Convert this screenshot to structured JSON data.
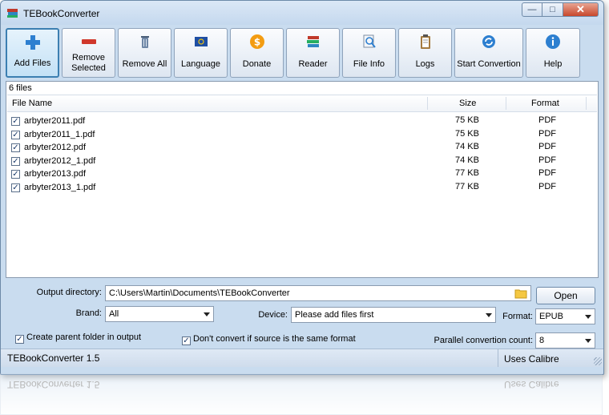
{
  "window": {
    "title": "TEBookConverter",
    "controls": {
      "minimize": "—",
      "maximize": "□",
      "close": "✕"
    }
  },
  "toolbar": {
    "buttons": [
      {
        "id": "add-files",
        "label": "Add Files",
        "icon": "plus-icon",
        "active": true
      },
      {
        "id": "remove-selected",
        "label": "Remove Selected",
        "icon": "minus-icon"
      },
      {
        "id": "remove-all",
        "label": "Remove All",
        "icon": "trash-icon"
      },
      {
        "id": "language",
        "label": "Language",
        "icon": "flag-icon"
      },
      {
        "id": "donate",
        "label": "Donate",
        "icon": "dollar-coin-icon"
      },
      {
        "id": "reader",
        "label": "Reader",
        "icon": "books-icon"
      },
      {
        "id": "file-info",
        "label": "File Info",
        "icon": "magnifier-icon"
      },
      {
        "id": "logs",
        "label": "Logs",
        "icon": "clipboard-icon"
      },
      {
        "id": "start-convertion",
        "label": "Start Convertion",
        "icon": "refresh-icon"
      },
      {
        "id": "help",
        "label": "Help",
        "icon": "info-icon"
      }
    ]
  },
  "files": {
    "count_label": "6 files",
    "columns": {
      "name": "File Name",
      "size": "Size",
      "format": "Format"
    },
    "rows": [
      {
        "name": "arbyter2011.pdf",
        "size": "75 KB",
        "format": "PDF",
        "checked": true
      },
      {
        "name": "arbyter2011_1.pdf",
        "size": "75 KB",
        "format": "PDF",
        "checked": true
      },
      {
        "name": "arbyter2012.pdf",
        "size": "74 KB",
        "format": "PDF",
        "checked": true
      },
      {
        "name": "arbyter2012_1.pdf",
        "size": "74 KB",
        "format": "PDF",
        "checked": true
      },
      {
        "name": "arbyter2013.pdf",
        "size": "77 KB",
        "format": "PDF",
        "checked": true
      },
      {
        "name": "arbyter2013_1.pdf",
        "size": "77 KB",
        "format": "PDF",
        "checked": true
      }
    ]
  },
  "options": {
    "output_label": "Output directory:",
    "output_value": "C:\\Users\\Martin\\Documents\\TEBookConverter",
    "open_label": "Open",
    "brand_label": "Brand:",
    "brand_value": "All",
    "device_label": "Device:",
    "device_value": "Please add files first",
    "format_label": "Format:",
    "format_value": "EPUB",
    "create_parent_label": "Create parent folder in output",
    "dont_convert_label": "Don't convert if source is the same format",
    "parallel_label": "Parallel convertion count:",
    "parallel_value": "8"
  },
  "status": {
    "version": "TEBookConverter 1.5",
    "engine": "Uses Calibre"
  },
  "colors": {
    "accent": "#3c7fb1",
    "frame": "#c9dcef"
  }
}
